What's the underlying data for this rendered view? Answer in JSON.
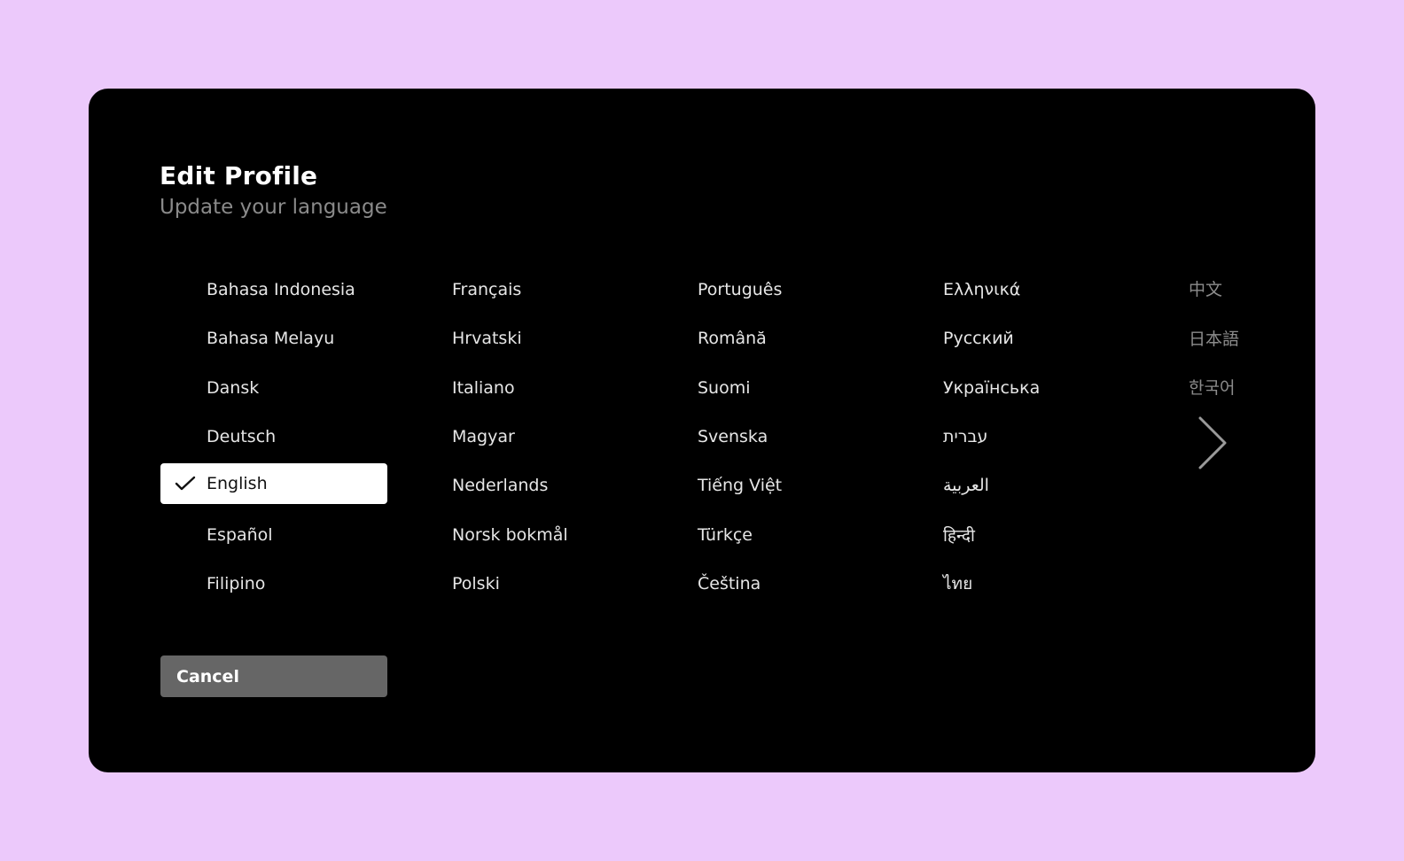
{
  "header": {
    "title": "Edit Profile",
    "subtitle": "Update your language"
  },
  "languages": {
    "col1": [
      "Bahasa Indonesia",
      "Bahasa Melayu",
      "Dansk",
      "Deutsch",
      "English",
      "Español",
      "Filipino"
    ],
    "col2": [
      "Français",
      "Hrvatski",
      "Italiano",
      "Magyar",
      "Nederlands",
      "Norsk bokmål",
      "Polski"
    ],
    "col3": [
      "Português",
      "Română",
      "Suomi",
      "Svenska",
      "Tiếng Việt",
      "Türkçe",
      "Čeština"
    ],
    "col4": [
      "Ελληνικά",
      "Русский",
      "Українська",
      "עברית",
      "العربية",
      "हिन्दी",
      "ไทย"
    ],
    "col5": [
      "中文",
      "日本語",
      "한국어"
    ],
    "selected": "English"
  },
  "actions": {
    "cancel_label": "Cancel"
  },
  "icons": {
    "selected_marker": "check-icon",
    "next_page": "chevron-right-icon"
  },
  "colors": {
    "page_background": "#ecc9fb",
    "screen_background": "#000000",
    "selected_background": "#ffffff",
    "cancel_background": "#666666"
  }
}
